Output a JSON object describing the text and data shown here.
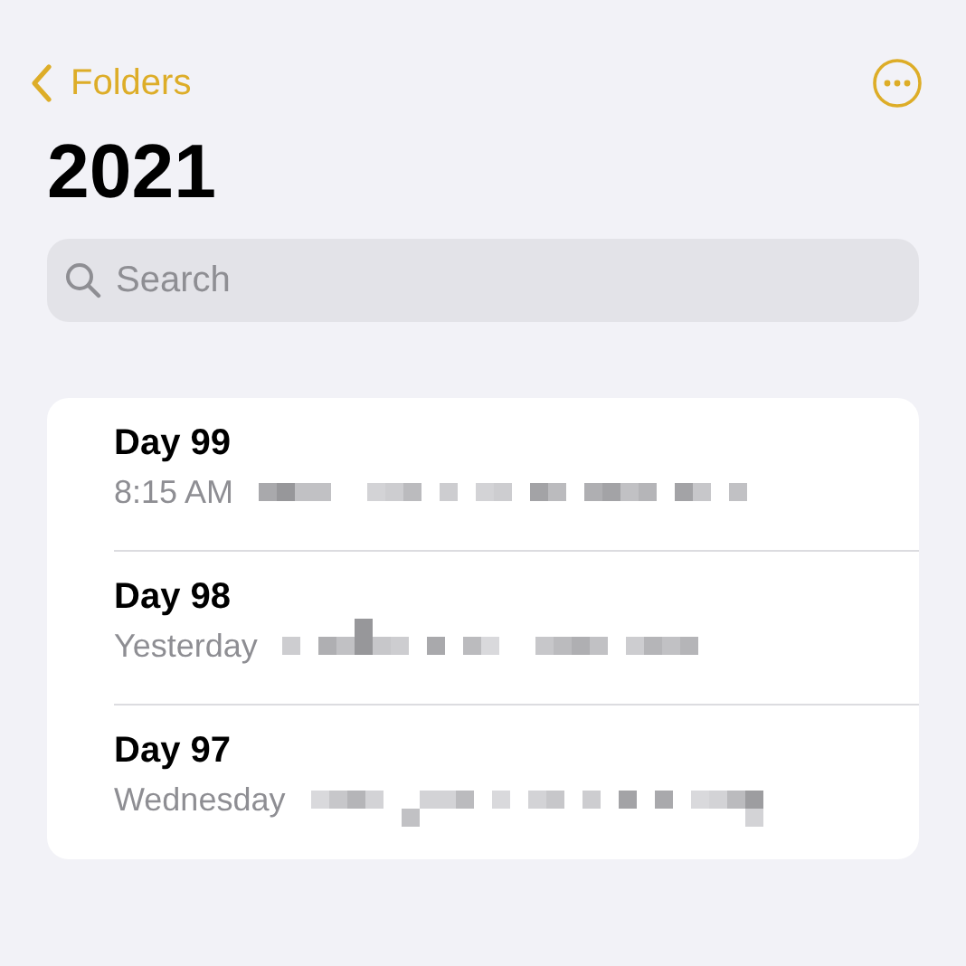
{
  "nav": {
    "back_label": "Folders"
  },
  "title": "2021",
  "search": {
    "placeholder": "Search"
  },
  "notes": [
    {
      "title": "Day 99",
      "date": "8:15 AM"
    },
    {
      "title": "Day 98",
      "date": "Yesterday"
    },
    {
      "title": "Day 97",
      "date": "Wednesday"
    }
  ]
}
